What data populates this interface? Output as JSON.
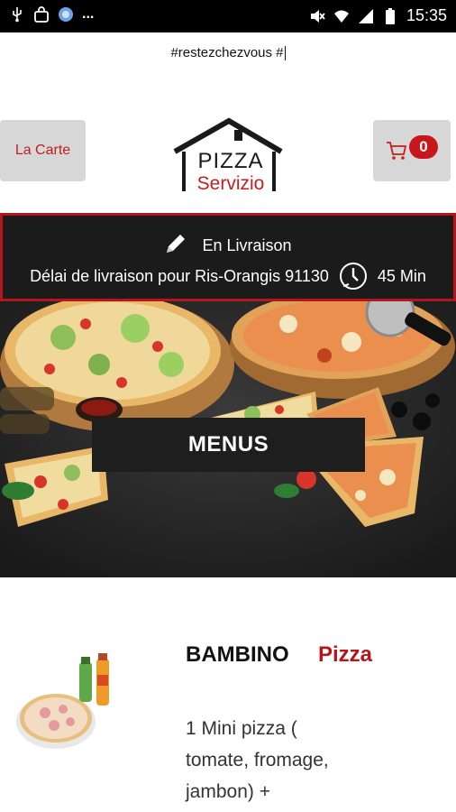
{
  "status_bar": {
    "time": "15:35",
    "more": "...",
    "left_icons": [
      "usb-icon",
      "bag-icon",
      "chat-bubble-icon"
    ],
    "right_icons": [
      "mute-icon",
      "wifi-icon",
      "signal-icon",
      "battery-icon"
    ]
  },
  "header": {
    "hashtag": "#restezchezvous #",
    "carte_label": "La Carte",
    "cart_count": "0"
  },
  "logo": {
    "line1": "PIZZA",
    "line2": "Servizio"
  },
  "delivery": {
    "mode": "En Livraison",
    "delay_text": "Délai de livraison pour Ris-Orangis 91130",
    "duration": "45 Min"
  },
  "hero": {
    "menus_label": "MENUS"
  },
  "product": {
    "name": "BAMBINO",
    "category": "Pizza",
    "description": "1 Mini pizza ( tomate, fromage, jambon) +"
  },
  "colors": {
    "accent": "#c41e1e",
    "dark": "#1b1b1b",
    "button_bg": "#d7d7d7"
  }
}
